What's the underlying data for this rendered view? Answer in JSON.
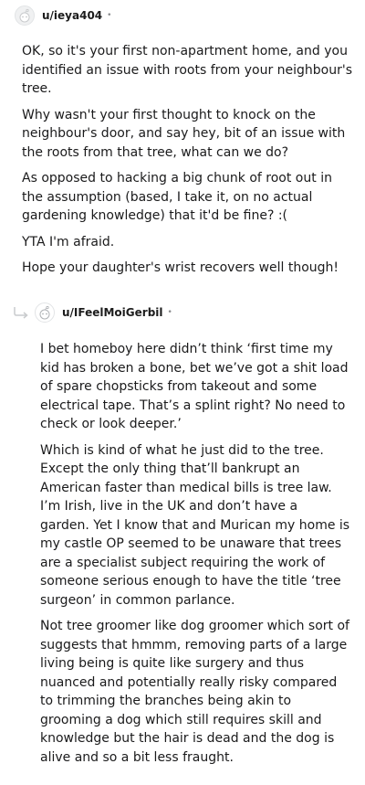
{
  "comment1": {
    "author": "u/ieya404",
    "separator": "•",
    "avatar_icon": "snoo-avatar-icon",
    "paragraphs": [
      "OK, so it's your first non-apartment home, and you identified an issue with roots from your neighbour's tree.",
      "Why wasn't your first thought to knock on the neighbour's door, and say hey, bit of an issue with the roots from that tree, what can we do?",
      "As opposed to hacking a big chunk of root out in the assumption (based, I take it, on no actual gardening knowledge) that it'd be fine? :(",
      "YTA I'm afraid.",
      "Hope your daughter's wrist recovers well though!"
    ]
  },
  "comment2": {
    "author": "u/IFeelMoiGerbil",
    "separator": "•",
    "avatar_icon": "snoo-avatar-icon",
    "reply_icon": "reply-arrow-icon",
    "paragraphs": [
      "I bet homeboy here didn’t think ‘first time my kid has broken a bone, bet we’ve got a shit load of spare chopsticks from takeout and some electrical tape. That’s a splint right? No need to check or look deeper.’",
      "Which is kind of what he just did to the tree. Except the only thing that’ll bankrupt an American faster than medical bills is tree law. I’m Irish, live in the UK and don’t have a garden. Yet I know that and Murican my home is my castle OP seemed to be unaware that trees are a specialist subject requiring the work of someone serious enough to have the title ‘tree surgeon’ in common parlance.",
      "Not tree groomer like dog groomer which sort of suggests that hmmm, removing parts of a large living being is quite like surgery and thus nuanced and potentially really risky compared to trimming the branches being akin to grooming a dog which still requires skill and knowledge but the hair is dead and the dog is alive and so a bit less fraught."
    ]
  }
}
